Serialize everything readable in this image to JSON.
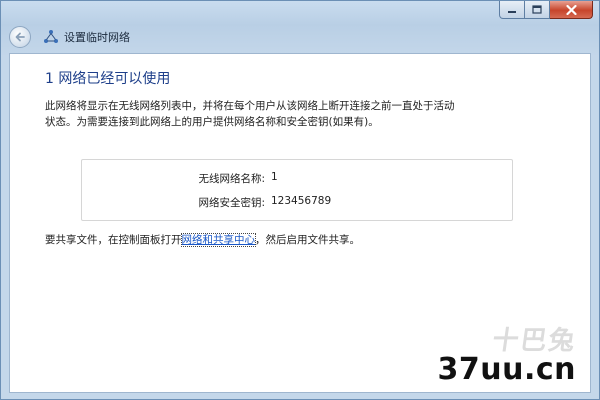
{
  "window": {
    "title": "设置临时网络",
    "buttons": {
      "minimize": "minimize-icon",
      "maximize": "maximize-icon",
      "close": "close-icon"
    }
  },
  "content": {
    "heading": "1 网络已经可以使用",
    "description_line1": "此网络将显示在无线网络列表中，并将在每个用户从该网络上断开连接之前一直处于活动",
    "description_line2": "状态。为需要连接到此网络上的用户提供网络名称和安全密钥(如果有)。",
    "network_name_label": "无线网络名称:",
    "network_name_value": "1",
    "security_key_label": "网络安全密钥:",
    "security_key_value": "123456789",
    "share_prefix": "要共享文件，在控制面板打开",
    "share_link": "网络和共享中心",
    "share_suffix": "，然后启用文件共享。"
  },
  "watermark": {
    "faded_text": "十巴兔",
    "site": "37uu.cn"
  },
  "colors": {
    "heading": "#1e3f8a",
    "link": "#1a57c6",
    "close_button": "#c7452b"
  }
}
